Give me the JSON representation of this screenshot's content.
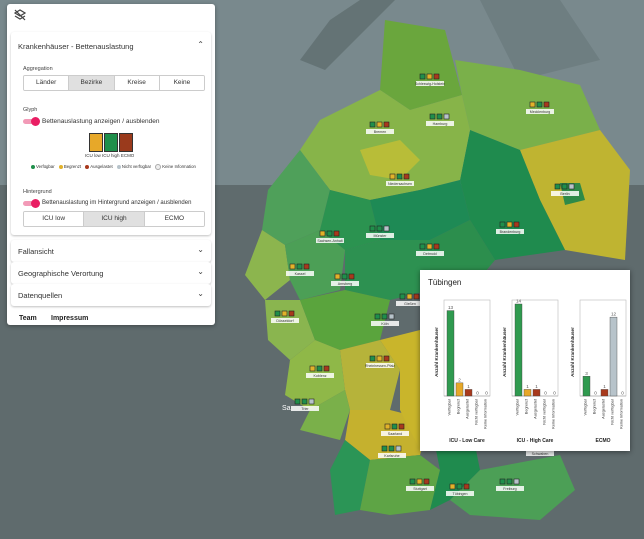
{
  "panel": {
    "top_icon": "layers-off-icon",
    "section_title": "Krankenhäuser - Bettenauslastung",
    "aggregation": {
      "label": "Aggregation",
      "options": [
        "Länder",
        "Bezirke",
        "Kreise",
        "Keine"
      ],
      "selected": "Bezirke"
    },
    "glyph": {
      "label": "Glyph",
      "toggle_label": "Bettenauslastung anzeigen / ausblenden",
      "toggle_on": true,
      "sample_colors": [
        "#e7a829",
        "#1f8f4b",
        "#9a3a1c"
      ],
      "sample_labels": [
        "ICU low",
        "ICU high",
        "ECMO"
      ]
    },
    "legend": [
      {
        "label": "Verfügbar",
        "color": "#1f8f4b"
      },
      {
        "label": "Begrenzt",
        "color": "#e2b22a"
      },
      {
        "label": "Ausgelastet",
        "color": "#a8391c"
      },
      {
        "label": "Nicht verfügbar",
        "color": "#b7c3ca"
      },
      {
        "label": "Keine Information",
        "color": "#eeeeee"
      }
    ],
    "background": {
      "label": "Hintergrund",
      "toggle_label": "Bettenauslastung im Hintergrund anzeigen / ausblenden",
      "toggle_on": true,
      "options": [
        "ICU low",
        "ICU high",
        "ECMO"
      ],
      "selected": "ICU high"
    },
    "sections": [
      "Fallansicht",
      "Geographische Verortung",
      "Datenquellen"
    ],
    "footer_links": [
      "Team",
      "Impressum"
    ]
  },
  "map": {
    "city_labels": [
      "Schleswig-Holstein",
      "Mecklenburg",
      "Hamburg",
      "Bremen",
      "Niedersachsen",
      "Berlin",
      "Brandenburg",
      "Sachsen-Anhalt",
      "Münster",
      "Detmold",
      "Kassel",
      "Leipzig",
      "Düsseldorf",
      "Arnsberg",
      "Köln",
      "Gießen",
      "Koblenz",
      "Trier",
      "Rheinhessen-Pfalz",
      "Saarland",
      "Karlsruhe",
      "Stuttgart",
      "Tübingen",
      "Freiburg",
      "Schwaben",
      "Oberbayern",
      "Niederbayern"
    ],
    "place_label": "Sa"
  },
  "popup": {
    "title": "Tübingen",
    "y_axis_title": "Anzahl Krankenhäuser",
    "categories": [
      "Verfügbar",
      "Begrenzt",
      "Ausgelastet",
      "Nicht verfügbar",
      "Keine Information"
    ],
    "colors": [
      "#2f9a4f",
      "#e7a829",
      "#a8391c",
      "#b7c3ca",
      "#eeeeee"
    ],
    "charts": [
      {
        "title": "ICU - Low Care",
        "values": [
          13,
          2,
          1,
          0,
          0
        ]
      },
      {
        "title": "ICU - High Care",
        "values": [
          14,
          1,
          1,
          0,
          0
        ]
      },
      {
        "title": "ECMO",
        "values": [
          3,
          0,
          1,
          12,
          0
        ]
      }
    ]
  }
}
